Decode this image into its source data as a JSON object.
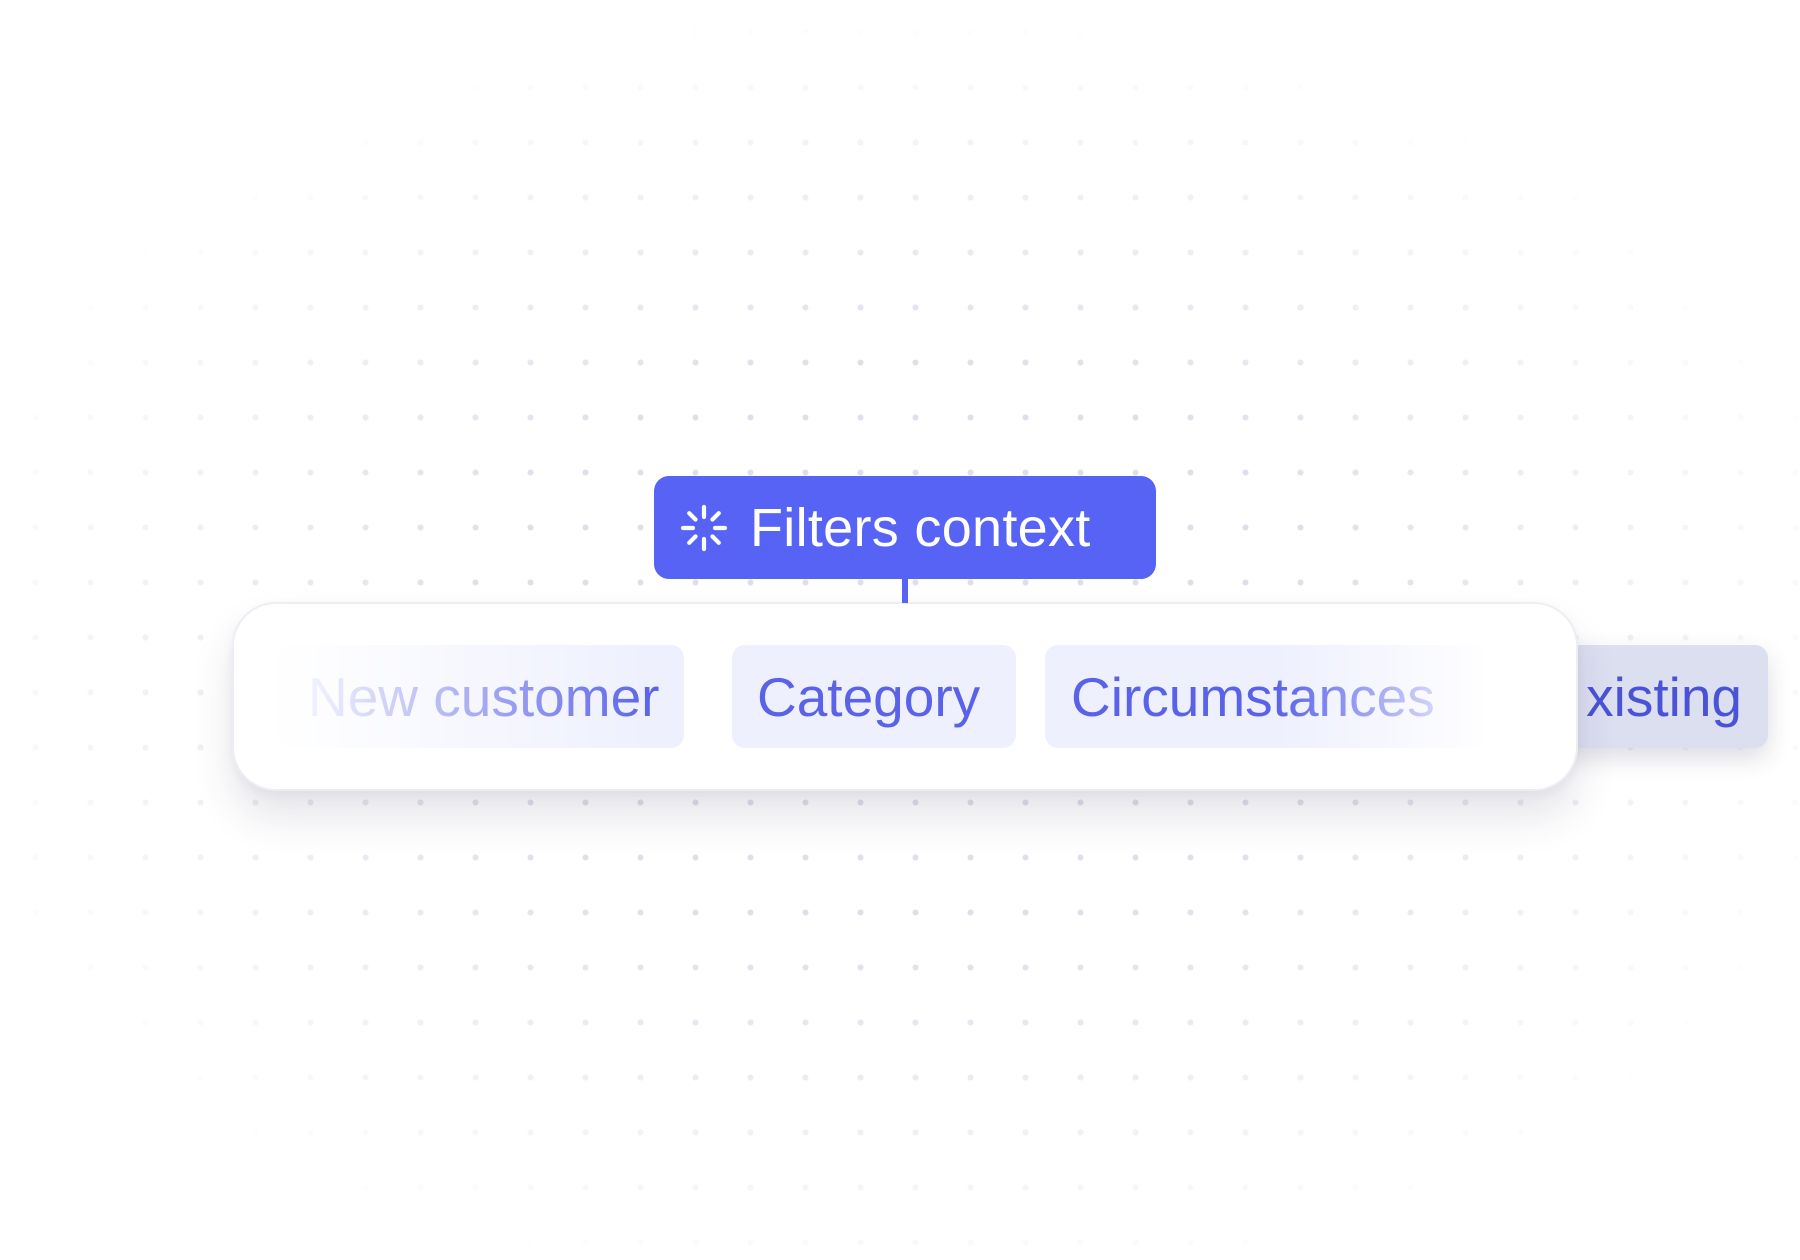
{
  "context_label": {
    "text": "Filters context",
    "icon": "loading-spinner-icon",
    "color": "#5763f5"
  },
  "chips": [
    {
      "label": "New customer"
    },
    {
      "label": "Category"
    },
    {
      "label": "Circumstances"
    },
    {
      "label": "xisting"
    }
  ],
  "colors": {
    "chip_background": "#eef0fe",
    "chip_text": "#5a63e8",
    "panel_background": "#ffffff",
    "grid_dot": "#d9dbe6"
  }
}
